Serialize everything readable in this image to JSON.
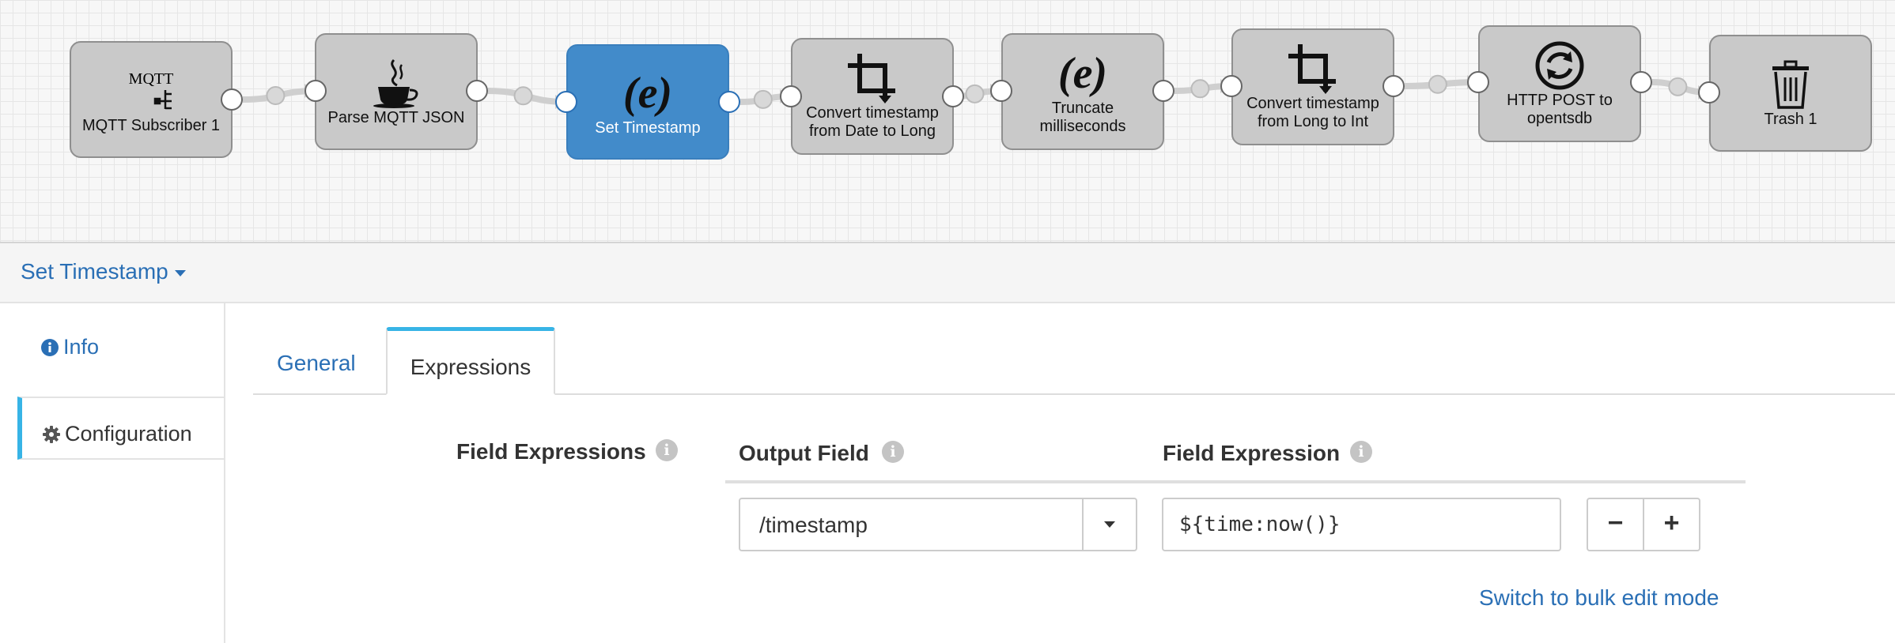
{
  "pipeline": {
    "nodes": [
      {
        "id": "mqtt",
        "label": "MQTT Subscriber 1",
        "icon": "mqtt-icon",
        "icon_text": "MQTT",
        "selected": false
      },
      {
        "id": "parse",
        "label": "Parse MQTT JSON",
        "icon": "java-cup-icon",
        "selected": false
      },
      {
        "id": "settime",
        "label": "Set Timestamp",
        "icon": "expression-icon",
        "selected": true
      },
      {
        "id": "convert1",
        "label": "Convert timestamp from Date to Long",
        "icon": "crop-icon",
        "selected": false
      },
      {
        "id": "truncate",
        "label": "Truncate milliseconds",
        "icon": "expression-icon",
        "selected": false
      },
      {
        "id": "convert2",
        "label": "Convert timestamp from Long to Int",
        "icon": "crop-icon",
        "selected": false
      },
      {
        "id": "http",
        "label": "HTTP POST to opentsdb",
        "icon": "sync-icon",
        "selected": false
      },
      {
        "id": "trash",
        "label": "Trash 1",
        "icon": "trash-icon",
        "selected": false
      }
    ]
  },
  "stage_header": {
    "title": "Set Timestamp"
  },
  "left_nav": {
    "info_label": "Info",
    "config_label": "Configuration"
  },
  "tabs": {
    "general": "General",
    "expressions": "Expressions"
  },
  "form": {
    "field_expressions_label": "Field Expressions",
    "output_field_label": "Output Field",
    "field_expression_label": "Field Expression",
    "output_field_value": "/timestamp",
    "field_expression_value": "${time:now()}",
    "minus": "−",
    "plus": "+",
    "bulk_edit_link": "Switch to bulk edit mode"
  },
  "colors": {
    "accent": "#2a6fb5",
    "selected_node": "#428bca",
    "tab_highlight": "#37b4e6",
    "node_bg": "#c9c9c9"
  }
}
